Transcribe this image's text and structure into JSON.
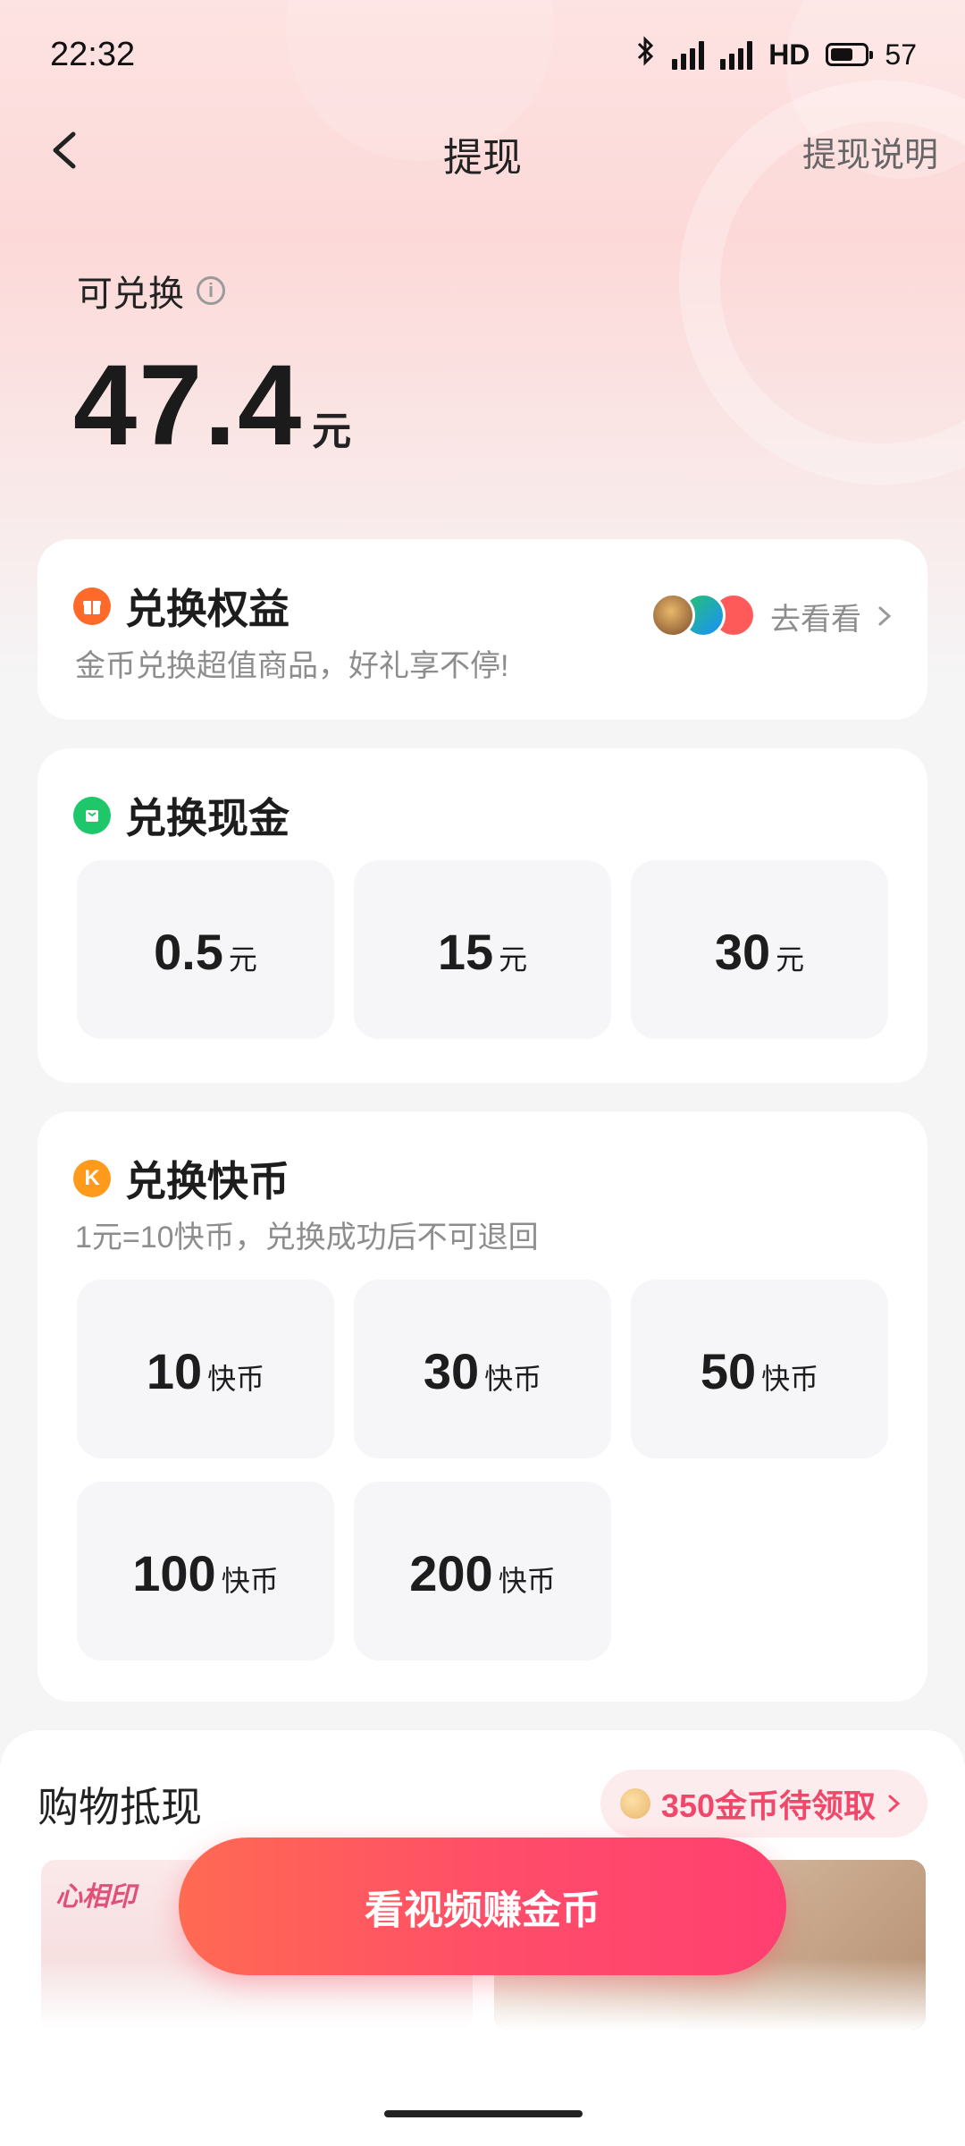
{
  "status_bar": {
    "time": "22:32",
    "network_label": "HD",
    "battery_level": "57"
  },
  "nav": {
    "title": "提现",
    "help_label": "提现说明"
  },
  "balance": {
    "label": "可兑换",
    "amount": "47.4",
    "unit": "元"
  },
  "benefits": {
    "title": "兑换权益",
    "subtitle": "金币兑换超值商品，好礼享不停!",
    "link_label": "去看看"
  },
  "cash": {
    "title": "兑换现金",
    "options": [
      {
        "value": "0.5",
        "unit": "元"
      },
      {
        "value": "15",
        "unit": "元"
      },
      {
        "value": "30",
        "unit": "元"
      }
    ]
  },
  "kuaibi": {
    "title": "兑换快币",
    "subtitle": "1元=10快币，兑换成功后不可退回",
    "options": [
      {
        "value": "10",
        "unit": "快币"
      },
      {
        "value": "30",
        "unit": "快币"
      },
      {
        "value": "50",
        "unit": "快币"
      },
      {
        "value": "100",
        "unit": "快币"
      },
      {
        "value": "200",
        "unit": "快币"
      }
    ]
  },
  "shopping": {
    "title": "购物抵现",
    "coins_pending": "350金币待领取",
    "brand_text": "心相印"
  },
  "cta": {
    "label": "看视频赚金币"
  },
  "colors": {
    "accent": "#ff4c6a",
    "gift_orange": "#ff6a2a",
    "cash_green": "#1ec76a",
    "coin_orange": "#ff9a1a"
  }
}
